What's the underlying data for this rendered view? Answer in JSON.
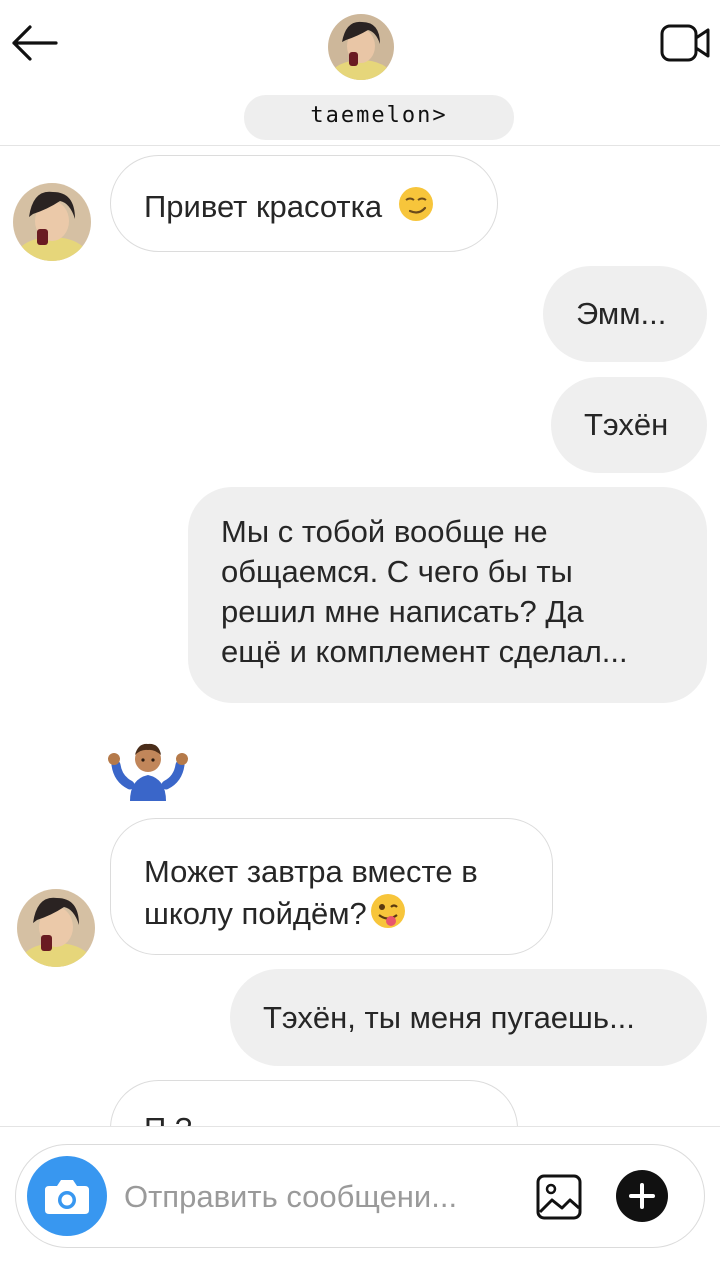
{
  "header": {
    "username": "taemelon>",
    "back_icon": "arrow-left-icon",
    "video_icon": "video-call-icon"
  },
  "messages": [
    {
      "side": "in",
      "text": "Привет красотка",
      "emoji": "smirking-face"
    },
    {
      "side": "out",
      "text": "Эмм..."
    },
    {
      "side": "out",
      "text": "Тэхён"
    },
    {
      "side": "out",
      "text": "Мы с тобой вообще не общаемся. С чего бы ты решил мне написать? Да ещё и комплемент сделал...",
      "lines": [
        "Мы с тобой вообще не",
        "общаемся. С чего бы ты",
        "решил мне написать? Да",
        "ещё и комплемент сделал..."
      ]
    },
    {
      "side": "in",
      "emoji": "person-shrugging"
    },
    {
      "side": "in",
      "text": "Может завтра вместе в школу пойдём?",
      "lines": [
        "Может завтра вместе в",
        "школу пойдём?"
      ],
      "emoji": "winking-face-with-tongue"
    },
    {
      "side": "out",
      "text": "Тэхён, ты меня пугаешь..."
    },
    {
      "side": "in",
      "text": "П ?",
      "partial": true
    }
  ],
  "composer": {
    "placeholder": "Отправить сообщени...",
    "camera_icon": "camera-icon",
    "gallery_icon": "image-icon",
    "add_icon": "plus-icon"
  },
  "colors": {
    "accent": "#3897f0",
    "incoming_bubble_border": "#dcdcdc",
    "outgoing_bubble_bg": "#efefef"
  }
}
